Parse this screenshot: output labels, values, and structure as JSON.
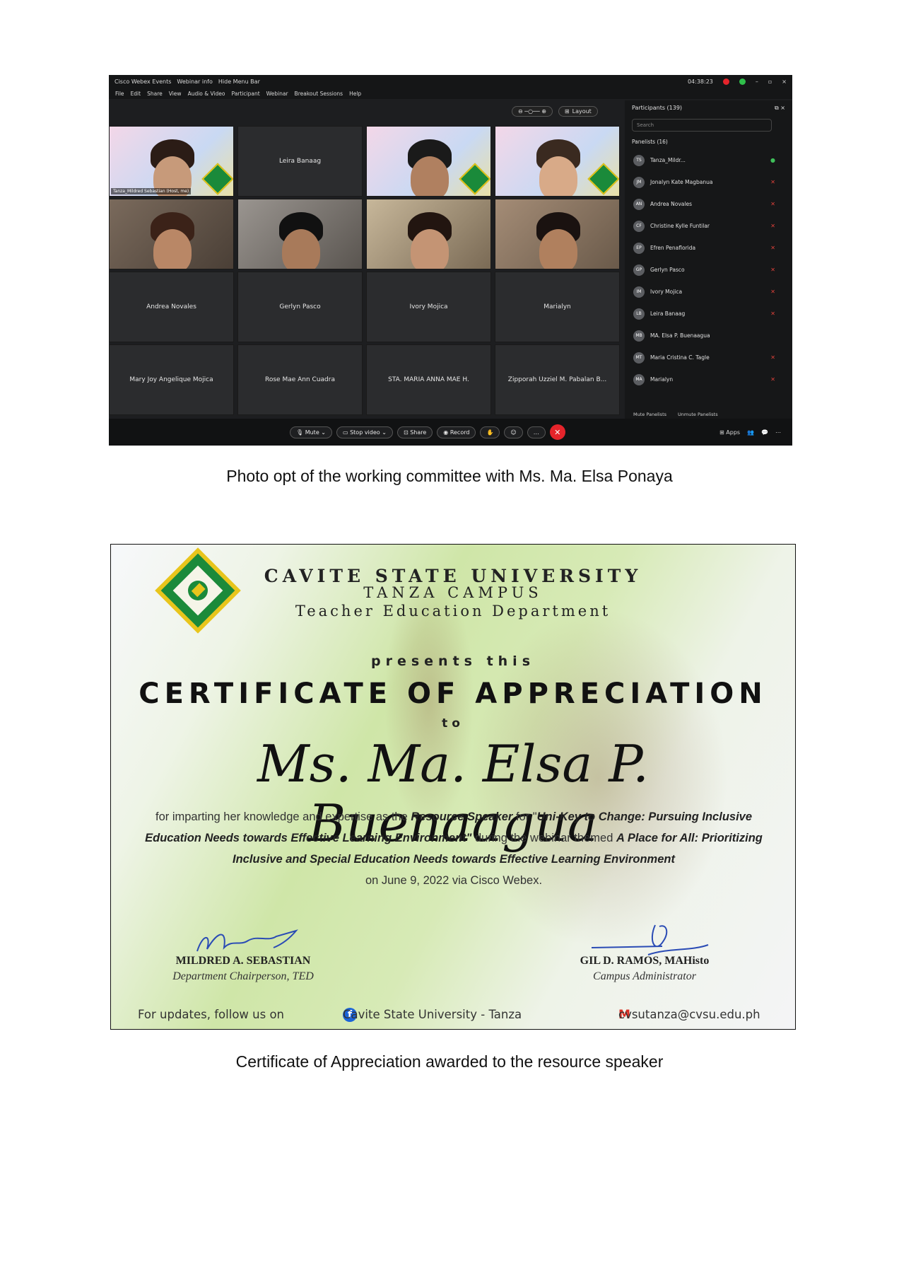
{
  "webex": {
    "app_title": "Cisco Webex Events",
    "webinar_info": "Webinar info",
    "hide_menu": "Hide Menu Bar",
    "clock": "04:38:23",
    "menu": [
      "File",
      "Edit",
      "Share",
      "View",
      "Audio & Video",
      "Participant",
      "Webinar",
      "Breakout Sessions",
      "Help"
    ],
    "layout_label": "Layout",
    "tiles": [
      {
        "label": "Tanza_Mildred Sebastian (Host, me)",
        "kind": "slide"
      },
      {
        "label": "Leira Banaag",
        "kind": "name"
      },
      {
        "label": "",
        "kind": "slide"
      },
      {
        "label": "",
        "kind": "slide"
      },
      {
        "label": "",
        "kind": "video"
      },
      {
        "label": "",
        "kind": "video"
      },
      {
        "label": "",
        "kind": "video"
      },
      {
        "label": "",
        "kind": "video"
      },
      {
        "label": "Andrea Novales",
        "kind": "name"
      },
      {
        "label": "Gerlyn Pasco",
        "kind": "name"
      },
      {
        "label": "Ivory Mojica",
        "kind": "name"
      },
      {
        "label": "Marialyn",
        "kind": "name"
      },
      {
        "label": "Mary Joy Angelique Mojica",
        "kind": "name"
      },
      {
        "label": "Rose Mae Ann Cuadra",
        "kind": "name"
      },
      {
        "label": "STA. MARIA ANNA MAE H.",
        "kind": "name"
      },
      {
        "label": "Zipporah Uzziel M. Pabalan B...",
        "kind": "name"
      }
    ],
    "participants_header": "Participants (139)",
    "search_placeholder": "Search",
    "panelists_header": "Panelists (16)",
    "panelists": [
      {
        "initials": "TS",
        "name": "Tanza_Mildr..."
      },
      {
        "initials": "JM",
        "name": "Jonalyn Kate Magbanua"
      },
      {
        "initials": "AN",
        "name": "Andrea Novales"
      },
      {
        "initials": "CF",
        "name": "Christine Kylle Funtilar"
      },
      {
        "initials": "EP",
        "name": "Efren Penaflorida"
      },
      {
        "initials": "GP",
        "name": "Gerlyn Pasco"
      },
      {
        "initials": "IM",
        "name": "Ivory Mojica"
      },
      {
        "initials": "LB",
        "name": "Leira Banaag"
      },
      {
        "initials": "MB",
        "name": "MA. Elsa P. Buenaagua"
      },
      {
        "initials": "MT",
        "name": "Maria Cristina C. Tagle"
      },
      {
        "initials": "MA",
        "name": "Marialyn"
      }
    ],
    "mute_panelists": "Mute Panelists",
    "unmute_panelists": "Unmute Panelists",
    "controls": {
      "mute": "Mute",
      "stop_video": "Stop video",
      "share": "Share",
      "record": "Record",
      "apps": "Apps"
    }
  },
  "caption1": "Photo opt of the working committee with Ms. Ma. Elsa Ponaya",
  "certificate": {
    "university": "CAVITE STATE UNIVERSITY",
    "campus": "TANZA CAMPUS",
    "department": "Teacher Education Department",
    "presents": "presents this",
    "title": "CERTIFICATE OF APPRECIATION",
    "to": "to",
    "recipient": "Ms. Ma. Elsa P. Buenaagua",
    "body": {
      "t1": "for imparting her knowledge and expertise as the ",
      "b1": "Resource Speaker",
      "t2": " for \"",
      "b2": "Uni-Key to Change: Pursuing Inclusive Education Needs towards Effective Learning Environment\"",
      "t3": " during the webinar themed ",
      "b3": "A Place for All: Prioritizing Inclusive and Special Education Needs towards Effective Learning Environment",
      "t4": "on June 9, 2022 via Cisco Webex."
    },
    "signatory_left": {
      "name": "MILDRED A. SEBASTIAN",
      "position": "Department Chairperson, TED"
    },
    "signatory_right": {
      "name": "GIL D. RAMOS, MAHisto",
      "position": "Campus Administrator"
    },
    "footer": {
      "follow": "For updates, follow us on",
      "facebook": "Cavite State University - Tanza",
      "email": "cvsutanza@cvsu.edu.ph"
    }
  },
  "caption2": "Certificate of Appreciation awarded to the resource speaker"
}
